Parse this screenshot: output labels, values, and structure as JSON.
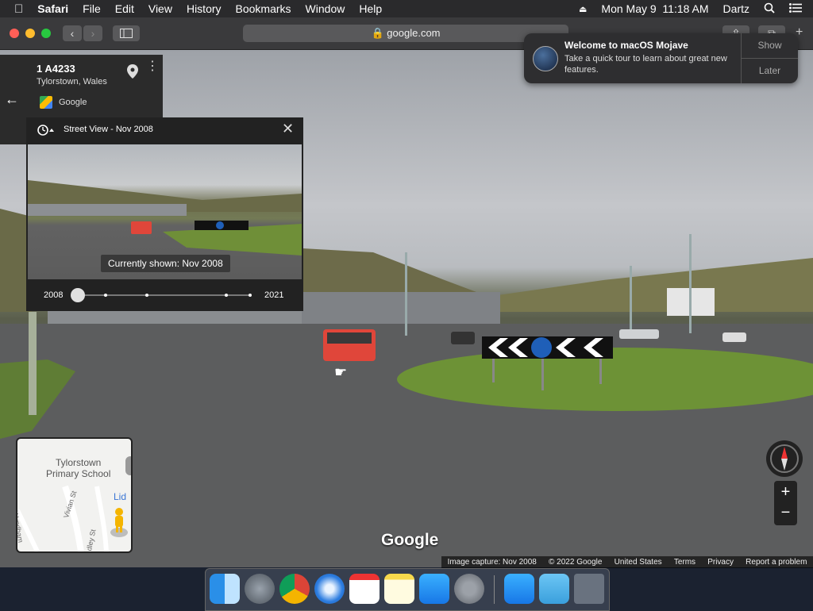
{
  "menubar": {
    "app_name": "Safari",
    "menus": [
      "File",
      "Edit",
      "View",
      "History",
      "Bookmarks",
      "Window",
      "Help"
    ],
    "datetime": "Mon May 9  11:18 AM",
    "user": "Dartz"
  },
  "toolbar": {
    "address": "google.com"
  },
  "notification": {
    "title": "Welcome to macOS Mojave",
    "body": "Take a quick tour to learn about great new features.",
    "show_label": "Show",
    "later_label": "Later"
  },
  "place_card": {
    "road": "1 A4233",
    "location": "Tylorstown, Wales",
    "source": "Google"
  },
  "street_view_panel": {
    "title": "Street View - Nov 2008",
    "tooltip": "Currently shown: Nov 2008",
    "year_start": "2008",
    "year_end": "2021",
    "timeline_fraction": 0.0
  },
  "minimap": {
    "school_label": "Tylorstown\nPrimary School",
    "lidl_label": "Lid",
    "streets": [
      "Vivian St",
      "dley St",
      "Wyndham"
    ]
  },
  "watermark": "Google",
  "footer": {
    "capture": "Image capture: Nov 2008",
    "copyright": "© 2022 Google",
    "country": "United States",
    "terms": "Terms",
    "privacy": "Privacy",
    "report": "Report a problem"
  },
  "colors": {
    "close": "#ff5f57",
    "minimize": "#febc2e",
    "zoom": "#28c840",
    "van": "#e0463a"
  }
}
